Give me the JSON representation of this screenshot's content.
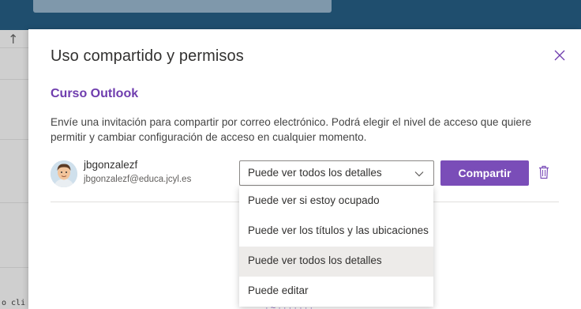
{
  "background": {
    "colors": {
      "topbar": "#1f4e6e",
      "panel": "#cfcfcf"
    },
    "left_icon": "↑",
    "bottom_left_partial": "o cli",
    "bottom_partial_link": "· ~ · ·   · · · · ·"
  },
  "dialog": {
    "title": "Uso compartido y permisos",
    "close_icon": "close-icon",
    "calendar_name": "Curso Outlook",
    "description": "Envíe una invitación para compartir por correo electrónico. Podrá elegir el nivel de acceso que quiere permitir y cambiar configuración de acceso en cualquier momento.",
    "user": {
      "name": "jbgonzalezf",
      "email": "jbgonzalezf@educa.jcyl.es",
      "avatar_icon": "avatar-icon"
    },
    "permission_select": {
      "selected": "Puede ver todos los detalles",
      "options": [
        "Puede ver si estoy ocupado",
        "Puede ver los títulos y las ubicaciones",
        "Puede ver todos los detalles",
        "Puede editar"
      ],
      "selected_index": 2
    },
    "share_button": "Compartir",
    "delete_icon": "trash-icon",
    "colors": {
      "accent": "#6f3dae",
      "button": "#7a4db8"
    }
  }
}
